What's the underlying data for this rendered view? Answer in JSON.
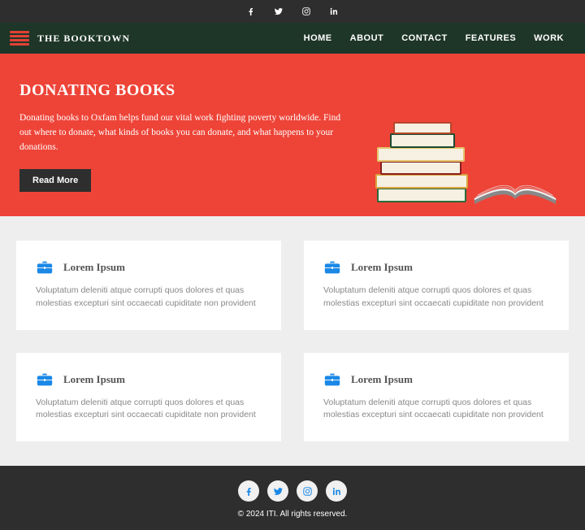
{
  "brand": "THE BOOKTOWN",
  "nav": [
    "HOME",
    "ABOUT",
    "CONTACT",
    "FEATURES",
    "WORK"
  ],
  "hero": {
    "title": "DONATING BOOKS",
    "text": "Donating books to Oxfam helps fund our vital work fighting poverty worldwide. Find out where to donate, what kinds of books you can donate, and what happens to your donations.",
    "cta": "Read More"
  },
  "cards": [
    {
      "title": "Lorem Ipsum",
      "text": "Voluptatum deleniti atque corrupti quos dolores et quas molestias excepturi sint occaecati cupiditate non provident"
    },
    {
      "title": "Lorem Ipsum",
      "text": "Voluptatum deleniti atque corrupti quos dolores et quas molestias excepturi sint occaecati cupiditate non provident"
    },
    {
      "title": "Lorem Ipsum",
      "text": "Voluptatum deleniti atque corrupti quos dolores et quas molestias excepturi sint occaecati cupiditate non provident"
    },
    {
      "title": "Lorem Ipsum",
      "text": "Voluptatum deleniti atque corrupti quos dolores et quas molestias excepturi sint occaecati cupiditate non provident"
    }
  ],
  "footer": {
    "copyright": "© 2024 ITI. All rights reserved."
  },
  "colors": {
    "accent": "#ee4438",
    "navbg": "#1e3628",
    "dark": "#2e2e2e",
    "icon": "#1a88e6"
  }
}
